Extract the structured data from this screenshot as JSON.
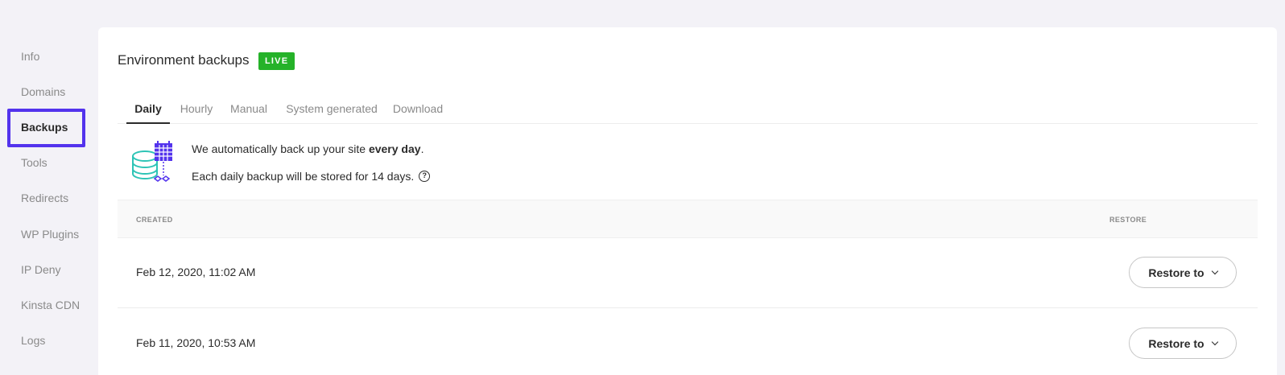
{
  "sidebar": {
    "items": [
      {
        "label": "Info"
      },
      {
        "label": "Domains"
      },
      {
        "label": "Backups"
      },
      {
        "label": "Tools"
      },
      {
        "label": "Redirects"
      },
      {
        "label": "WP Plugins"
      },
      {
        "label": "IP Deny"
      },
      {
        "label": "Kinsta CDN"
      },
      {
        "label": "Logs"
      }
    ],
    "active": "Backups"
  },
  "panel": {
    "title": "Environment backups",
    "badge": "LIVE",
    "badge_color": "#25b229",
    "highlight_color": "#5333ed"
  },
  "tabs": [
    {
      "label": "Daily"
    },
    {
      "label": "Hourly"
    },
    {
      "label": "Manual"
    },
    {
      "label": "System generated"
    },
    {
      "label": "Download"
    }
  ],
  "info": {
    "line1_prefix": "We automatically back up your site ",
    "line1_bold": "every day",
    "line1_suffix": ".",
    "line2": "Each daily backup will be stored for 14 days.",
    "help_glyph": "?",
    "icon": "database-calendar-icon"
  },
  "table": {
    "headers": {
      "created": "CREATED",
      "restore": "RESTORE"
    },
    "rows": [
      {
        "created": "Feb 12, 2020, 11:02 AM",
        "action": "Restore to"
      },
      {
        "created": "Feb 11, 2020, 10:53 AM",
        "action": "Restore to"
      }
    ]
  }
}
